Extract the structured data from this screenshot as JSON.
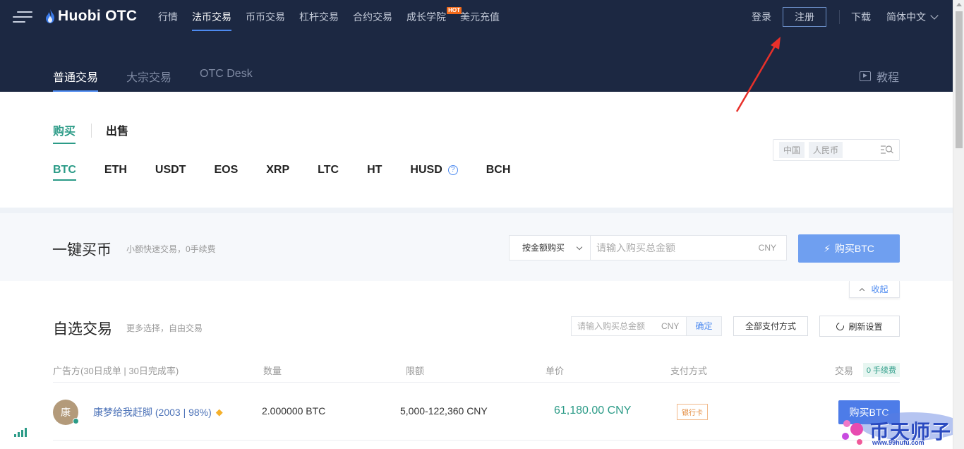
{
  "header": {
    "logo_text": "Huobi OTC",
    "nav": [
      {
        "label": "行情"
      },
      {
        "label": "法币交易",
        "active": true
      },
      {
        "label": "币币交易"
      },
      {
        "label": "杠杆交易"
      },
      {
        "label": "合约交易"
      },
      {
        "label": "成长学院",
        "badge": "HOT"
      },
      {
        "label": "美元充值"
      }
    ],
    "login": "登录",
    "register": "注册",
    "download": "下载",
    "language": "简体中文"
  },
  "subnav": {
    "tabs": [
      "普通交易",
      "大宗交易",
      "OTC Desk"
    ],
    "active_tab": "普通交易",
    "tutorial": "教程"
  },
  "trade_side": {
    "buy": "购买",
    "sell": "出售"
  },
  "coins": [
    "BTC",
    "ETH",
    "USDT",
    "EOS",
    "XRP",
    "LTC",
    "HT",
    "HUSD",
    "BCH"
  ],
  "active_coin": "BTC",
  "filter": {
    "country": "中国",
    "currency": "人民币"
  },
  "quick_buy": {
    "title": "一键买币",
    "subtitle": "小额快速交易，0手续费",
    "mode": "按金额购买",
    "placeholder": "请输入购买总金额",
    "unit": "CNY",
    "button": "购买BTC",
    "collapse": "收起"
  },
  "custom_trade": {
    "title": "自选交易",
    "subtitle": "更多选择，自由交易",
    "placeholder": "请输入购买总金额",
    "unit": "CNY",
    "confirm": "确定",
    "payment_filter": "全部支付方式",
    "refresh": "刷新设置"
  },
  "table": {
    "headers": {
      "advertiser": "广告方(30日成单 | 30日完成率)",
      "amount": "数量",
      "limit": "限额",
      "price": "单价",
      "payment": "支付方式",
      "trade": "交易",
      "fee": "0 手续费"
    },
    "rows": [
      {
        "avatar": "康",
        "merchant": "康梦给我赶脚 (2003 | 98%)",
        "amount": "2.000000 BTC",
        "limit": "5,000-122,360 CNY",
        "price": "61,180.00 CNY",
        "payment": "银行卡",
        "action": "购买BTC"
      }
    ]
  },
  "watermark": {
    "text": "币天师子",
    "url": "www.99hufu.com"
  },
  "colors": {
    "header_bg": "#1c2842",
    "accent_green": "#2b9b87",
    "accent_blue": "#4d8af0",
    "annotation_red": "#e8302a"
  }
}
